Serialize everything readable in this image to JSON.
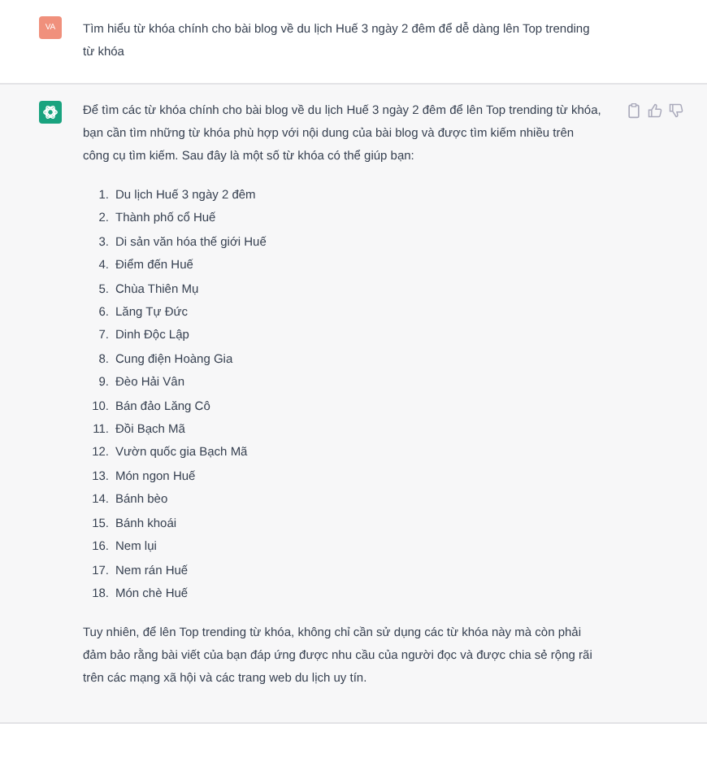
{
  "messages": [
    {
      "kind": "user",
      "avatar": "VA",
      "text": "Tìm hiểu từ khóa chính cho bài blog về du lịch Huế 3 ngày 2 đêm để dễ dàng lên Top trending từ khóa"
    },
    {
      "kind": "assistant",
      "intro": "Để tìm các từ khóa chính cho bài blog về du lịch Huế 3 ngày 2 đêm để lên Top trending từ khóa, bạn cần tìm những từ khóa phù hợp với nội dung của bài blog và được tìm kiếm nhiều trên công cụ tìm kiếm. Sau đây là một số từ khóa có thể giúp bạn:",
      "items": [
        {
          "number": "1.",
          "text": "Du lịch Huế 3 ngày 2 đêm"
        },
        {
          "number": "2.",
          "text": "Thành phố cổ Huế"
        },
        {
          "number": "3.",
          "text": "Di sản văn hóa thế giới Huế"
        },
        {
          "number": "4.",
          "text": "Điểm đến Huế"
        },
        {
          "number": "5.",
          "text": "Chùa Thiên Mụ"
        },
        {
          "number": "6.",
          "text": "Lăng Tự Đức"
        },
        {
          "number": "7.",
          "text": "Dinh Độc Lập"
        },
        {
          "number": "8.",
          "text": "Cung điện Hoàng Gia"
        },
        {
          "number": "9.",
          "text": "Đèo Hải Vân"
        },
        {
          "number": "10.",
          "text": "Bán đảo Lăng Cô"
        },
        {
          "number": "11.",
          "text": "Đồi Bạch Mã"
        },
        {
          "number": "12.",
          "text": "Vườn quốc gia Bạch Mã"
        },
        {
          "number": "13.",
          "text": "Món ngon Huế"
        },
        {
          "number": "14.",
          "text": "Bánh bèo"
        },
        {
          "number": "15.",
          "text": "Bánh khoái"
        },
        {
          "number": "16.",
          "text": "Nem lụi"
        },
        {
          "number": "17.",
          "text": "Nem rán Huế"
        },
        {
          "number": "18.",
          "text": "Món chè Huế"
        }
      ],
      "outro": "Tuy nhiên, để lên Top trending từ khóa, không chỉ cần sử dụng các từ khóa này mà còn phải đảm bảo rằng bài viết của bạn đáp ứng được nhu cầu của người đọc và được chia sẻ rộng rãi trên các mạng xã hội và các trang web du lịch uy tín."
    }
  ]
}
